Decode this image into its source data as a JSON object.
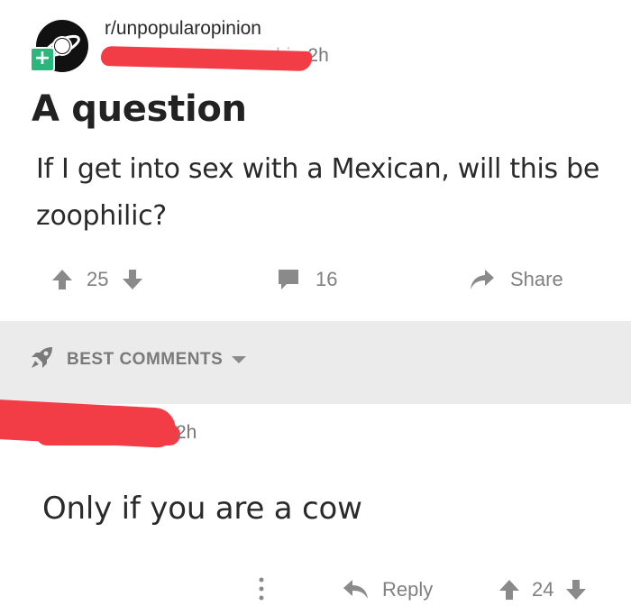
{
  "post": {
    "subreddit": "r/unpopularopinion",
    "author_tail": "hi",
    "separator": "•",
    "time": "2h",
    "title": "A question",
    "body": "If I get into sex with a Mexican, will this be zoophilic?",
    "upvotes": "25",
    "comments": "16",
    "share_label": "Share"
  },
  "comments_header": {
    "label": "BEST COMMENTS"
  },
  "comment": {
    "time": "2h",
    "text": "Only if you are a cow",
    "reply_label": "Reply",
    "upvotes": "24"
  },
  "colors": {
    "redaction": "#f23d47",
    "badge": "#2bb67d",
    "muted": "#808080",
    "band": "#ebebeb"
  }
}
